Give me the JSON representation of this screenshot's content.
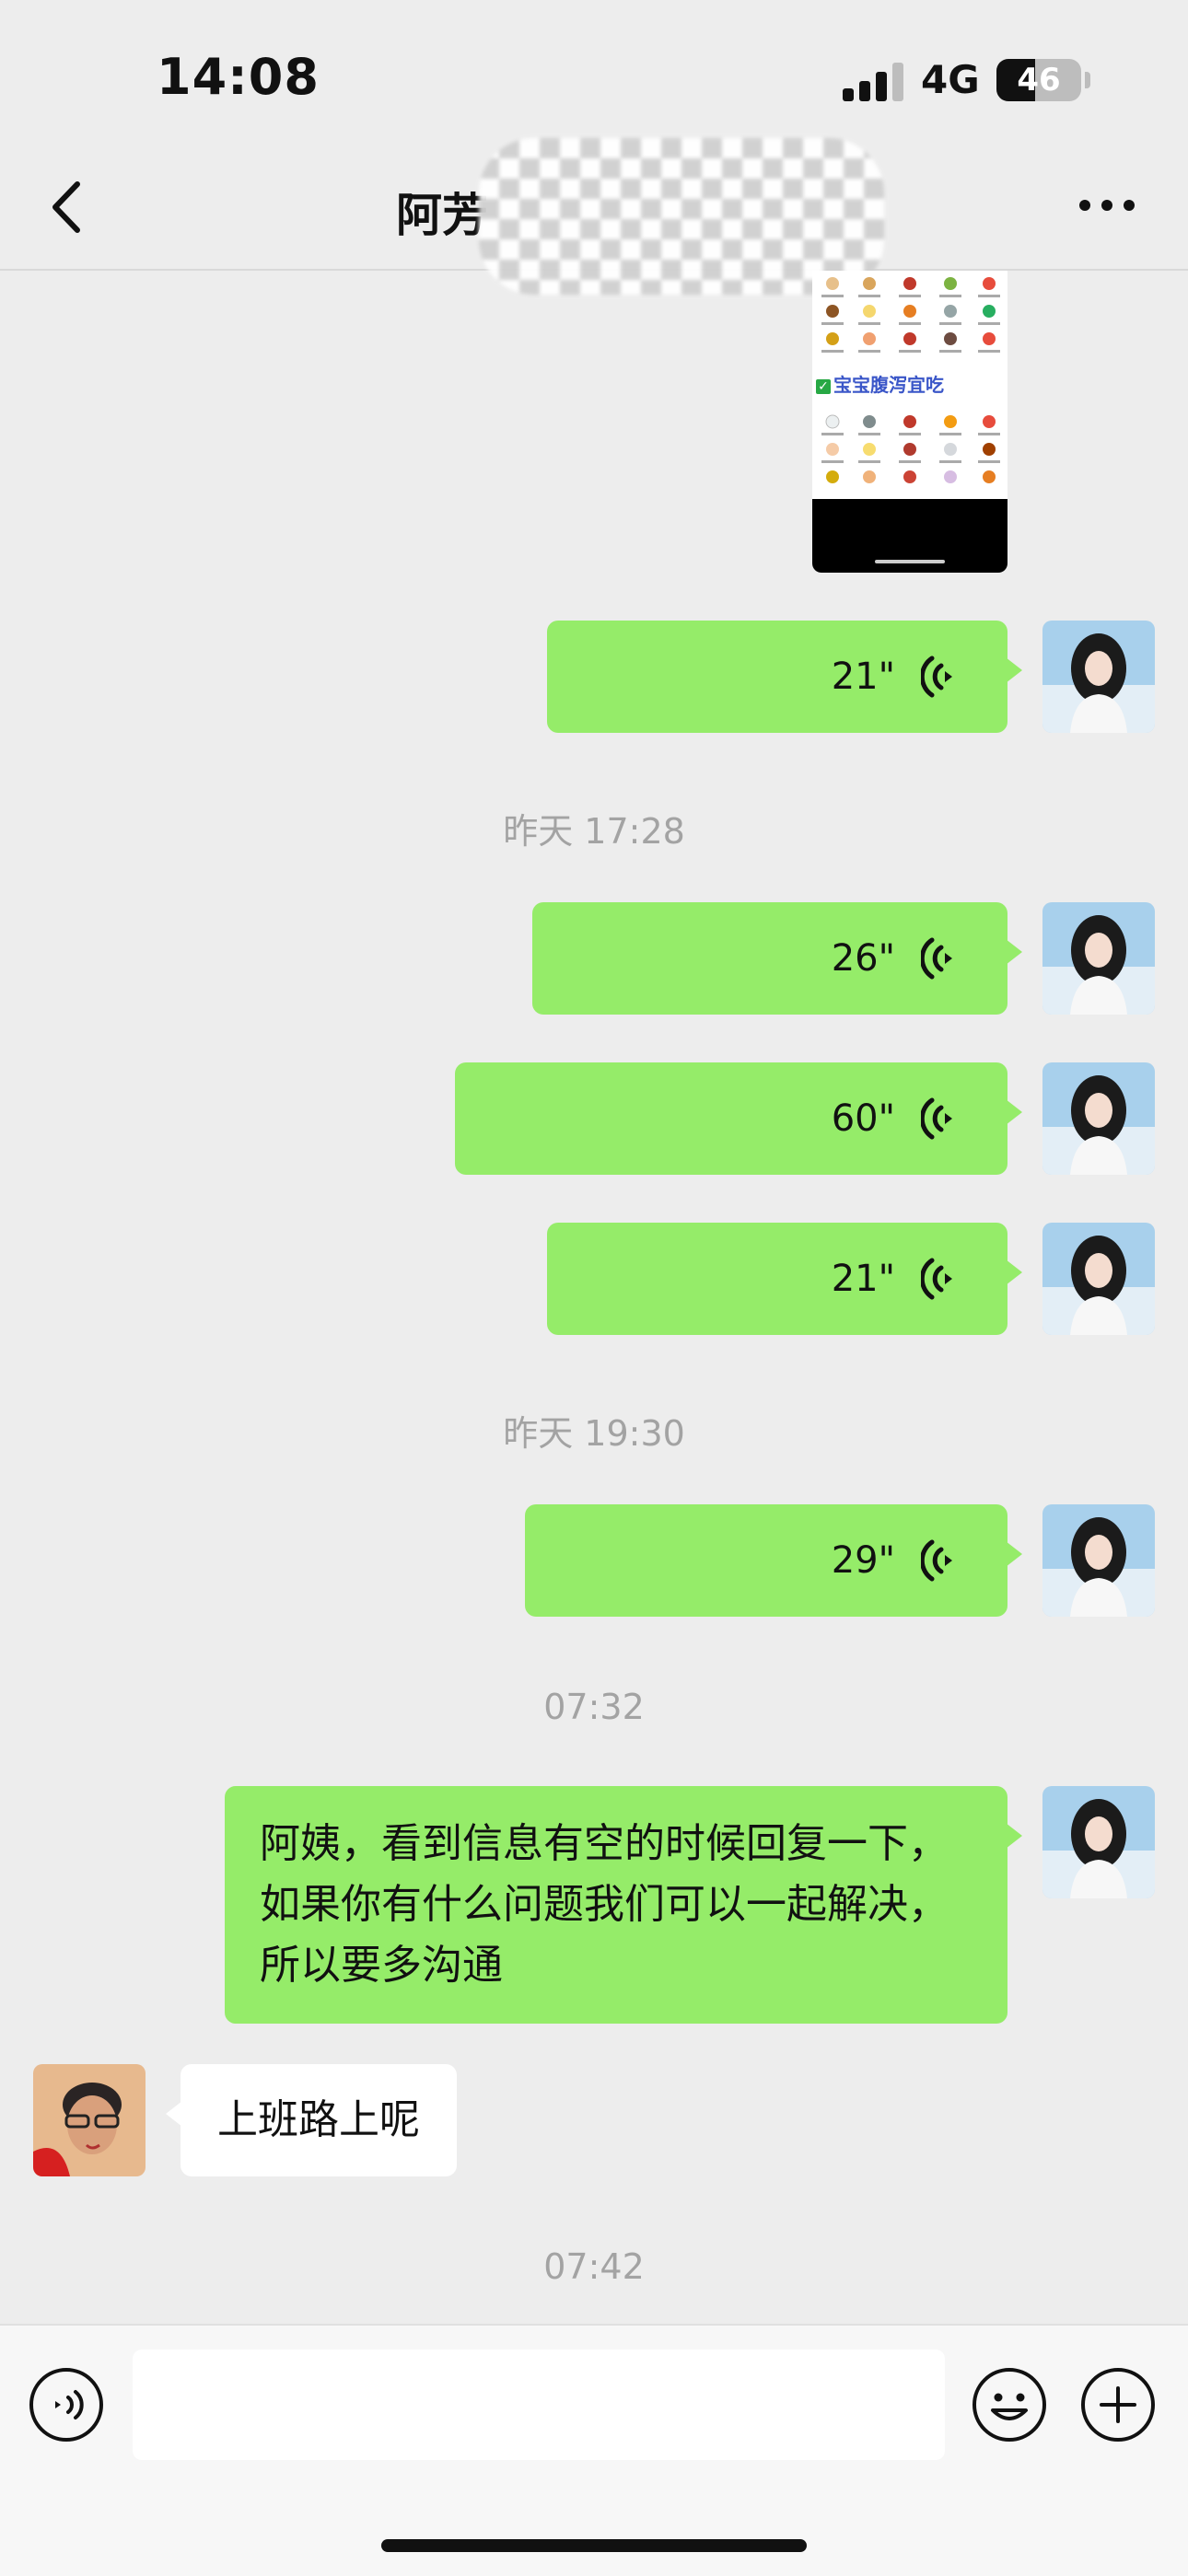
{
  "status_bar": {
    "time": "14:08",
    "network": "4G",
    "battery": "46",
    "battery_level": 0.46
  },
  "nav": {
    "title": "阿芳"
  },
  "image_message": {
    "caption": "宝宝腹泻宜吃"
  },
  "messages": {
    "voice_1": {
      "duration": "21\""
    },
    "time_1": "昨天 17:28",
    "voice_2": {
      "duration": "26\""
    },
    "voice_3": {
      "duration": "60\""
    },
    "voice_4": {
      "duration": "21\""
    },
    "time_2": "昨天 19:30",
    "voice_5": {
      "duration": "29\""
    },
    "time_3": "07:32",
    "text_1": "阿姨，看到信息有空的时候回复一下，如果你有什么问题我们可以一起解决，所以要多沟通",
    "reply_1": "上班路上呢",
    "time_4": "07:42"
  },
  "colors": {
    "background": "#ededed",
    "sent_bubble": "#95ec69",
    "received_bubble": "#ffffff",
    "timestamp": "#a3a3a3"
  },
  "icons": [
    "back-icon",
    "more-icon",
    "voice-wave-icon",
    "voice-toggle-icon",
    "emoji-icon",
    "plus-icon"
  ]
}
